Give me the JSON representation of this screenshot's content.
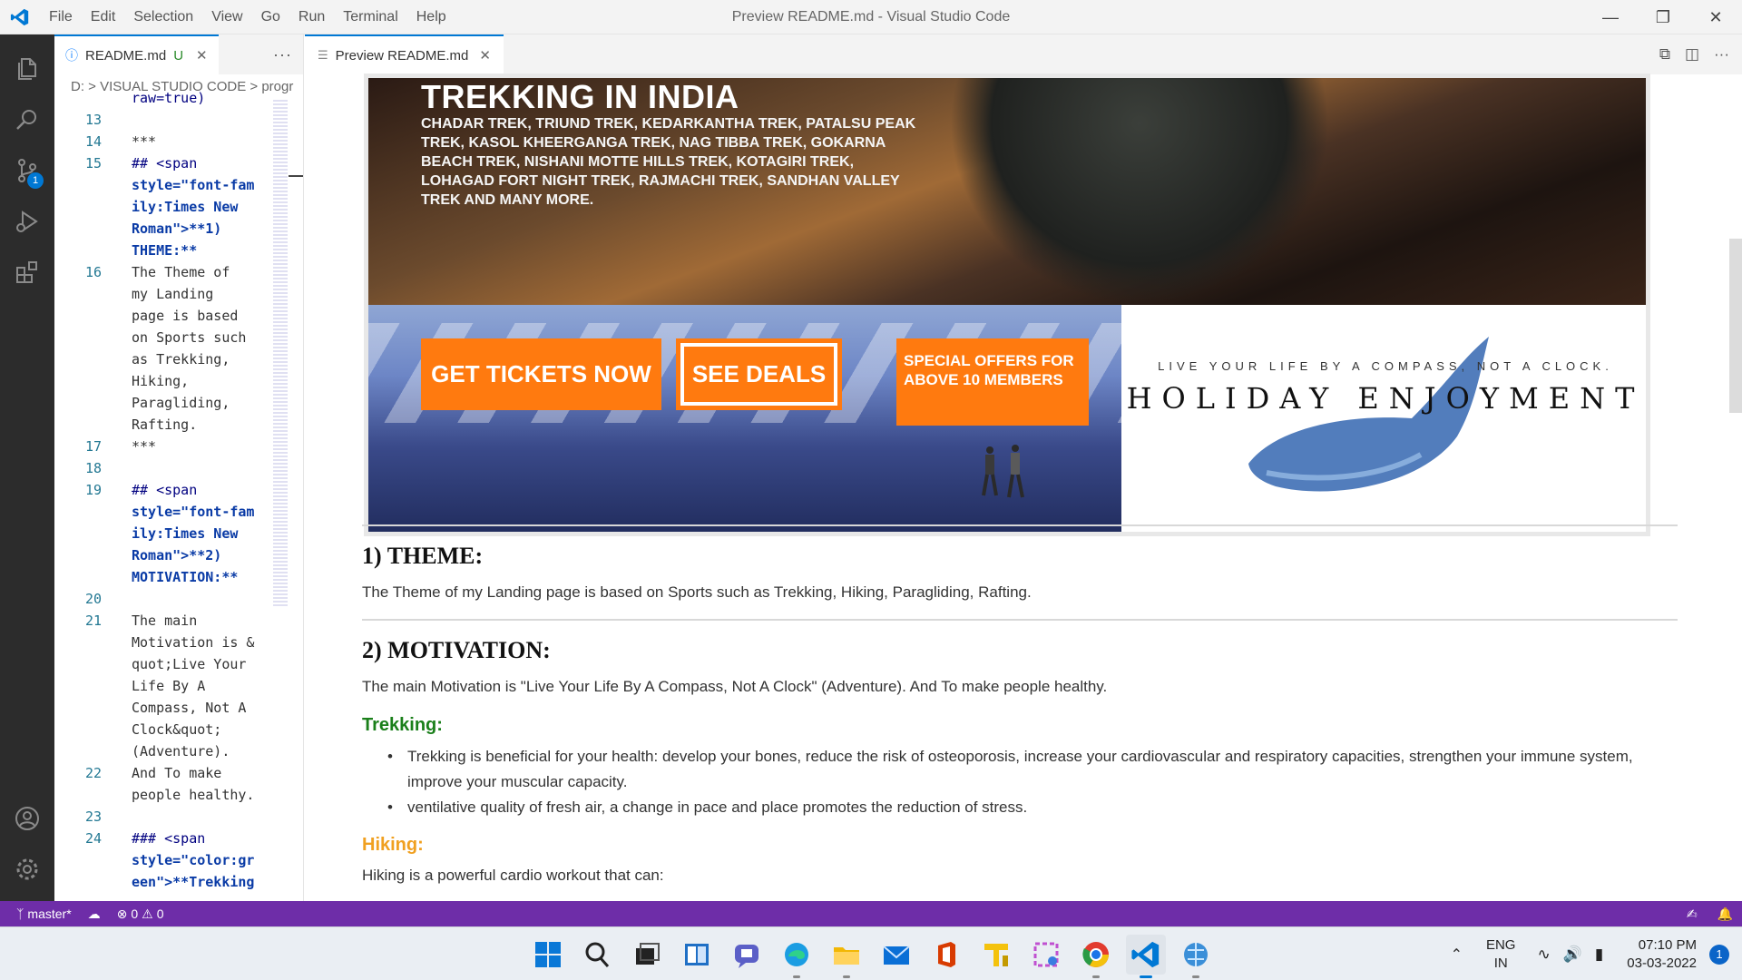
{
  "app": {
    "menu": [
      "File",
      "Edit",
      "Selection",
      "View",
      "Go",
      "Run",
      "Terminal",
      "Help"
    ],
    "window_title": "Preview README.md - Visual Studio Code"
  },
  "editor": {
    "tab_label": "README.md",
    "tab_status": "U",
    "breadcrumb": "D: > VISUAL STUDIO CODE > progr",
    "lines": [
      {
        "n": "",
        "t": "raw=true)",
        "s": "dark"
      },
      {
        "n": "13",
        "t": "",
        "s": ""
      },
      {
        "n": "14",
        "t": "***",
        "s": ""
      },
      {
        "n": "15",
        "t": "## <span",
        "s": "dark"
      },
      {
        "n": "",
        "t": "style=\"font-fam",
        "s": "blue"
      },
      {
        "n": "",
        "t": "ily:Times New",
        "s": "blue"
      },
      {
        "n": "",
        "t": "Roman\">**1)",
        "s": "blue"
      },
      {
        "n": "",
        "t": "THEME:**",
        "s": "blue"
      },
      {
        "n": "16",
        "t": "The Theme of",
        "s": ""
      },
      {
        "n": "",
        "t": "my Landing",
        "s": ""
      },
      {
        "n": "",
        "t": "page is based",
        "s": ""
      },
      {
        "n": "",
        "t": "on Sports such",
        "s": ""
      },
      {
        "n": "",
        "t": "as Trekking,",
        "s": ""
      },
      {
        "n": "",
        "t": "Hiking,",
        "s": ""
      },
      {
        "n": "",
        "t": "Paragliding,",
        "s": ""
      },
      {
        "n": "",
        "t": "Rafting.",
        "s": ""
      },
      {
        "n": "17",
        "t": "***",
        "s": ""
      },
      {
        "n": "18",
        "t": "",
        "s": ""
      },
      {
        "n": "19",
        "t": "## <span",
        "s": "dark"
      },
      {
        "n": "",
        "t": "style=\"font-fam",
        "s": "blue"
      },
      {
        "n": "",
        "t": "ily:Times New",
        "s": "blue"
      },
      {
        "n": "",
        "t": "Roman\">**2)",
        "s": "blue"
      },
      {
        "n": "",
        "t": "MOTIVATION:**",
        "s": "blue"
      },
      {
        "n": "20",
        "t": "",
        "s": ""
      },
      {
        "n": "21",
        "t": "The main",
        "s": ""
      },
      {
        "n": "",
        "t": "Motivation is &",
        "s": ""
      },
      {
        "n": "",
        "t": "quot;Live Your",
        "s": ""
      },
      {
        "n": "",
        "t": "Life By A",
        "s": ""
      },
      {
        "n": "",
        "t": "Compass, Not A",
        "s": ""
      },
      {
        "n": "",
        "t": "Clock&quot;",
        "s": ""
      },
      {
        "n": "",
        "t": "(Adventure).",
        "s": ""
      },
      {
        "n": "22",
        "t": "And To make",
        "s": ""
      },
      {
        "n": "",
        "t": "people healthy.",
        "s": ""
      },
      {
        "n": "23",
        "t": "",
        "s": ""
      },
      {
        "n": "24",
        "t": "### <span",
        "s": "dark"
      },
      {
        "n": "",
        "t": "style=\"color:gr",
        "s": "blue"
      },
      {
        "n": "",
        "t": "een\">**Trekking",
        "s": "blue"
      }
    ]
  },
  "preview": {
    "tab_label": "Preview README.md",
    "banner": {
      "title": "TREKKING IN INDIA",
      "treks": "CHADAR TREK, TRIUND TREK, KEDARKANTHA TREK, PATALSU PEAK TREK, KASOL KHEERGANGA TREK, NAG TIBBA TREK, GOKARNA BEACH TREK, NISHANI MOTTE HILLS TREK, KOTAGIRI TREK, LOHAGAD FORT NIGHT TREK, RAJMACHI TREK, SANDHAN VALLEY TREK AND MANY MORE.",
      "get_tickets": "GET TICKETS NOW",
      "see_deals": "SEE DEALS",
      "special_offers": "SPECIAL OFFERS FOR ABOVE 10 MEMBERS",
      "compass": "LIVE YOUR LIFE BY A COMPASS, NOT A CLOCK.",
      "holiday": "HOLIDAY ENJOYMENT"
    },
    "theme_heading": "1) THEME:",
    "theme_text": "The Theme of my Landing page is based on Sports such as Trekking, Hiking, Paragliding, Rafting.",
    "motivation_heading": "2) MOTIVATION:",
    "motivation_text": "The main Motivation is \"Live Your Life By A Compass, Not A Clock\" (Adventure). And To make people healthy.",
    "trekking_heading": "Trekking:",
    "trekking_color": "#1a7f1a",
    "trekking_points": [
      "Trekking is beneficial for your health: develop your bones, reduce the risk of osteoporosis, increase your cardiovascular and respiratory capacities, strengthen your immune system, improve your muscular capacity.",
      "ventilative quality of fresh air, a change in pace and place promotes the reduction of stress."
    ],
    "hiking_heading": "Hiking:",
    "hiking_color": "#f0a020",
    "hiking_text": "Hiking is a powerful cardio workout that can:"
  },
  "statusbar": {
    "branch": "master*",
    "errors": "0",
    "warnings": "0",
    "color": "#6e2da8"
  },
  "taskbar": {
    "lang_top": "ENG",
    "lang_bottom": "IN",
    "time": "07:10 PM",
    "date": "03-03-2022",
    "notifications": "1"
  },
  "activity": {
    "scm_badge": "1"
  }
}
